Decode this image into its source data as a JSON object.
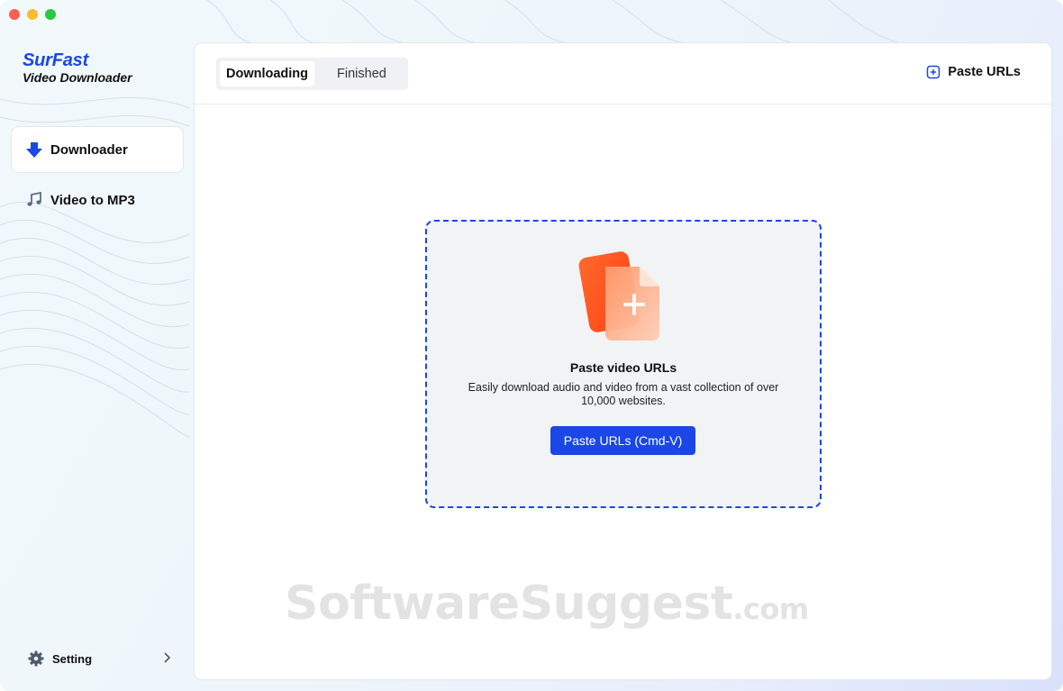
{
  "app": {
    "brand_name": "SurFast",
    "brand_sub": "Video Downloader"
  },
  "colors": {
    "accent": "#1a47e6",
    "close": "#fe5f57",
    "minimize": "#febc2e",
    "maximize": "#28c840",
    "icon_orange": "#ff5a1f"
  },
  "sidebar": {
    "items": [
      {
        "label": "Downloader",
        "icon": "download-arrow-icon",
        "active": true
      },
      {
        "label": "Video to MP3",
        "icon": "music-note-icon",
        "active": false
      }
    ],
    "setting_label": "Setting"
  },
  "header": {
    "tabs": [
      {
        "label": "Downloading",
        "active": true
      },
      {
        "label": "Finished",
        "active": false
      }
    ],
    "paste_label": "Paste URLs"
  },
  "dropzone": {
    "title": "Paste video URLs",
    "description": "Easily download audio and video from a vast collection of over 10,000 websites.",
    "button_label": "Paste URLs (Cmd-V)",
    "icon": "add-file-icon"
  },
  "watermark": {
    "main": "SoftwareSuggest",
    "suffix": ".com"
  }
}
